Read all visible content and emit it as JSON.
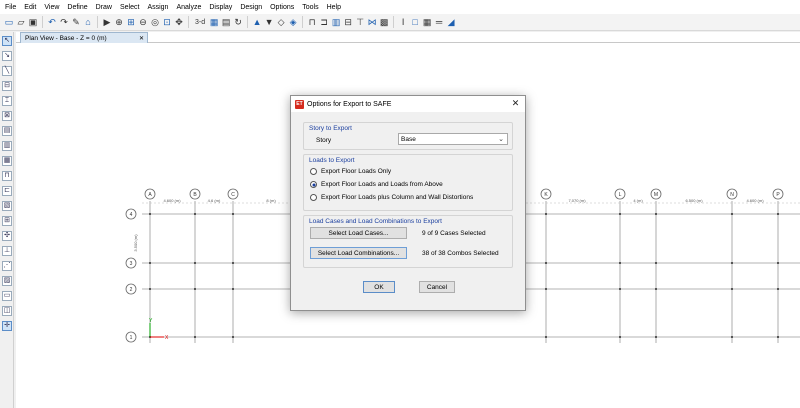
{
  "menu": [
    "File",
    "Edit",
    "View",
    "Define",
    "Draw",
    "Select",
    "Assign",
    "Analyze",
    "Display",
    "Design",
    "Options",
    "Tools",
    "Help"
  ],
  "toolbar": {
    "icons": [
      "new-icon",
      "open-icon",
      "save-icon",
      "undo-icon",
      "redo-icon",
      "pencil-icon",
      "lock-icon",
      "run-icon",
      "zoom-in-icon",
      "zoom-window-icon",
      "zoom-out-icon",
      "zoom-previous-icon",
      "zoom-fit-icon",
      "pan-icon",
      "view-3d-icon",
      "plan-view-icon",
      "elevation-icon",
      "rotate-icon",
      "story-up-icon",
      "story-down-icon",
      "object-shrink-icon",
      "display-options-icon",
      "section-cut-icon",
      "frame-icon",
      "wall-icon",
      "beam-icon",
      "column-icon",
      "brace-icon",
      "slab-icon",
      "text-icon",
      "rect-icon",
      "table-icon",
      "line-style-icon",
      "color-icon"
    ],
    "view_3d_label": "3-d"
  },
  "canvas": {
    "tab_title": "Plan View - Base - Z = 0 (m)"
  },
  "plan": {
    "column_grids": [
      "A",
      "B",
      "C",
      "K",
      "L",
      "M",
      "N",
      "P"
    ],
    "row_grids": [
      "4",
      "3",
      "2",
      "1"
    ],
    "spacings": [
      "4.600 (m)",
      "4.6 (m)",
      "8 (m)",
      "7.070 (m)",
      "4 (m)",
      "6.500 (m)",
      "4.600 (m)"
    ],
    "row_spacing": "3.500 (m)"
  },
  "dialog": {
    "title": "Options for Export to SAFE",
    "logo": "ET",
    "story_group": {
      "label": "Story to Export",
      "field_label": "Story",
      "selected": "Base"
    },
    "loads_group": {
      "label": "Loads to Export",
      "options": [
        "Export Floor Loads Only",
        "Export Floor Loads and Loads from Above",
        "Export Floor Loads plus Column and Wall Distortions"
      ],
      "selected_index": 1
    },
    "cases_group": {
      "label": "Load Cases and Load Combinations to Export",
      "cases_button": "Select Load Cases...",
      "cases_count": "9 of 9 Cases Selected",
      "combos_button": "Select Load Combinations...",
      "combos_count": "38 of 38 Combos Selected"
    },
    "ok_label": "OK",
    "cancel_label": "Cancel"
  },
  "colors": {
    "group_label": "#1a3e9e",
    "axis_x": "#e00000",
    "axis_y": "#00a000",
    "titlebar": "#ffffff"
  }
}
